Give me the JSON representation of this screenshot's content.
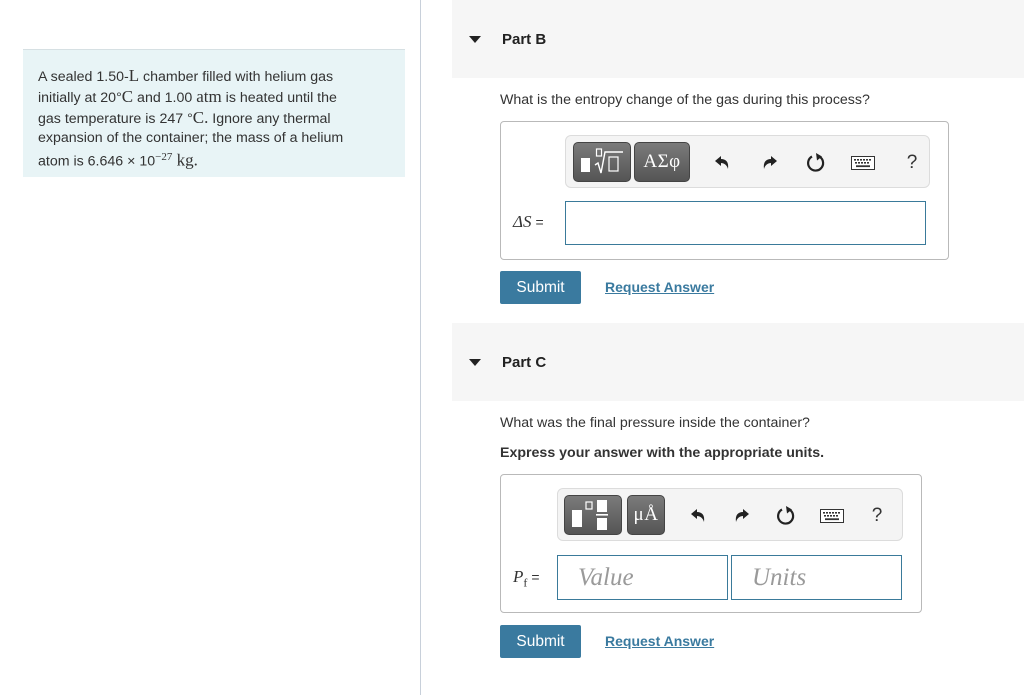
{
  "problem": {
    "line1_a": "A sealed 1.50-",
    "line1_unit": "L",
    "line1_b": " chamber filled with helium gas",
    "line2_a": "initially at 20",
    "line2_deg": "°",
    "line2_unit": "C",
    "line2_b": " and 1.00 ",
    "line2_atm": "atm",
    "line2_c": " is heated until the",
    "line3_a": "gas temperature is 247 ",
    "line3_deg": "°",
    "line3_unit": "C.",
    "line3_b": " Ignore any thermal",
    "line4": "expansion of the container; the mass of a helium",
    "line5_a": "atom is 6.646 × 10",
    "line5_exp": "−27",
    "line5_unit": " kg."
  },
  "parts": [
    {
      "title": "Part B",
      "question": "What is the entropy change of the gas during this process?",
      "toolbar": {
        "template_btn": "template-sqrt-icon",
        "symbols_label": "ΑΣφ",
        "undo": "undo-icon",
        "redo": "redo-icon",
        "reset": "reset-icon",
        "keyboard": "keyboard-icon",
        "help_label": "?"
      },
      "var_label": "ΔS",
      "eq": "=",
      "input_value": "",
      "submit_label": "Submit",
      "request_label": "Request Answer"
    },
    {
      "title": "Part C",
      "question": "What was the final pressure inside the container?",
      "instruction": "Express your answer with the appropriate units.",
      "toolbar": {
        "template_btn": "template-fraction-icon",
        "units_label": "μÅ",
        "undo": "undo-icon",
        "redo": "redo-icon",
        "reset": "reset-icon",
        "keyboard": "keyboard-icon",
        "help_label": "?"
      },
      "var_label": "P",
      "var_sub": "f",
      "eq": "=",
      "value_placeholder": "Value",
      "units_placeholder": "Units",
      "submit_label": "Submit",
      "request_label": "Request Answer"
    }
  ]
}
